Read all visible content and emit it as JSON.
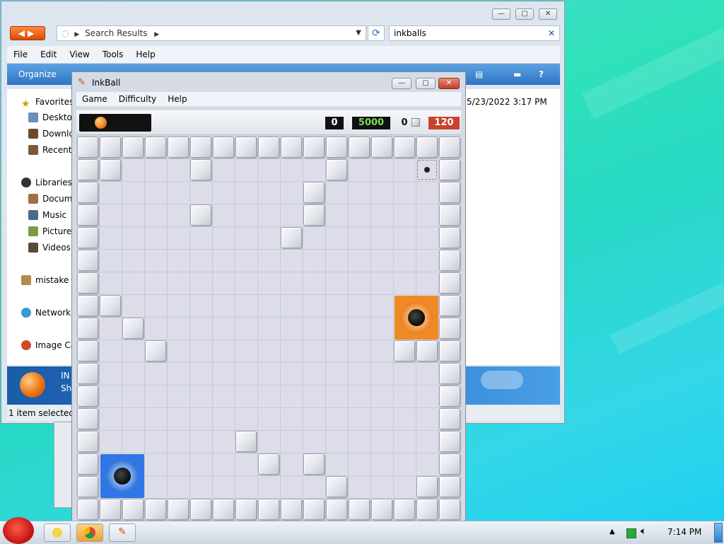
{
  "explorer": {
    "address": "Search Results",
    "search_value": "inkballs",
    "menu": [
      "File",
      "Edit",
      "View",
      "Tools",
      "Help"
    ],
    "toolbar_organize": "Organize",
    "date_modified": "5/23/2022 3:17 PM",
    "nav": {
      "favorites": "Favorites",
      "desktop": "Deskto",
      "downloads": "Downlo",
      "recent": "Recent",
      "libraries": "Libraries",
      "documents": "Docum",
      "music": "Music",
      "pictures": "Pictures",
      "videos": "Videos",
      "mistake": "mistake",
      "network": "Network",
      "image_ca": "Image Ca"
    },
    "details_name": "IN",
    "details_sub": "Sh",
    "status": "1 item selected"
  },
  "inkball": {
    "title": "InkBall",
    "menu": [
      "Game",
      "Difficulty",
      "Help"
    ],
    "score": "0",
    "target": "5000",
    "balls_left": "0",
    "timer": "120",
    "colors": {
      "orange": "#f08a24",
      "blue": "#2f76e6",
      "score_green": "#7ddc5a",
      "timer_red": "#c8442c"
    }
  },
  "taskbar": {
    "clock": "7:14 PM"
  }
}
